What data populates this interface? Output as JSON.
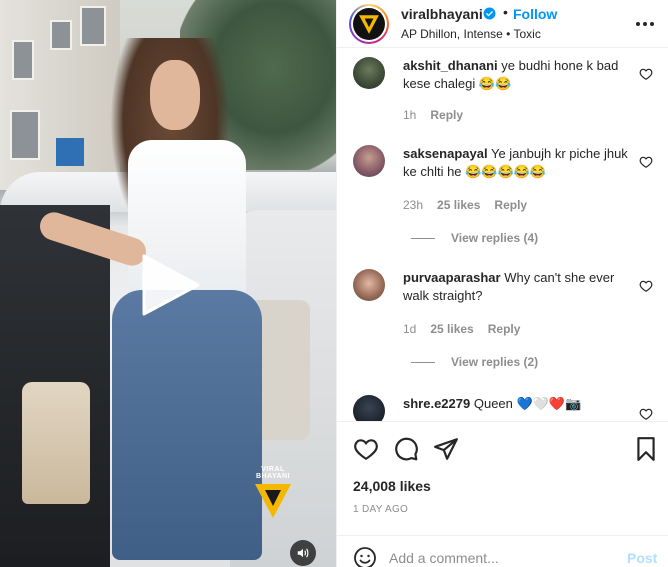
{
  "video": {
    "watermark_text": "VIRAL BHAYANI"
  },
  "header": {
    "username": "viralbhayani",
    "separator": "•",
    "follow_label": "Follow",
    "audio": "AP Dhillon, Intense • Toxic"
  },
  "comments": [
    {
      "user": "akshit_dhanani",
      "text": "ye budhi hone k bad kese chalegi 😂😂",
      "time": "1h",
      "likes": "",
      "reply_label": "Reply",
      "view_replies": ""
    },
    {
      "user": "saksenapayal",
      "text": "Ye janbujh kr piche jhuk ke chlti he 😂😂😂😂😂",
      "time": "23h",
      "likes": "25 likes",
      "reply_label": "Reply",
      "view_replies": "View replies (4)"
    },
    {
      "user": "purvaaparashar",
      "text": "Why can't she ever walk straight?",
      "time": "1d",
      "likes": "25 likes",
      "reply_label": "Reply",
      "view_replies": "View replies (2)"
    },
    {
      "user": "shre.e2279",
      "text": "Queen 💙🤍❤️📷",
      "time": "",
      "likes": "",
      "reply_label": "",
      "view_replies": ""
    }
  ],
  "stats": {
    "likes": "24,008 likes",
    "posted": "1 DAY AGO"
  },
  "add_comment": {
    "placeholder": "Add a comment...",
    "post_label": "Post"
  },
  "colors": {
    "accent": "#0095f6",
    "post_disabled": "#b2dffc",
    "text": "#262626",
    "muted": "#8e8e8e",
    "watermark": "#f5b800"
  }
}
